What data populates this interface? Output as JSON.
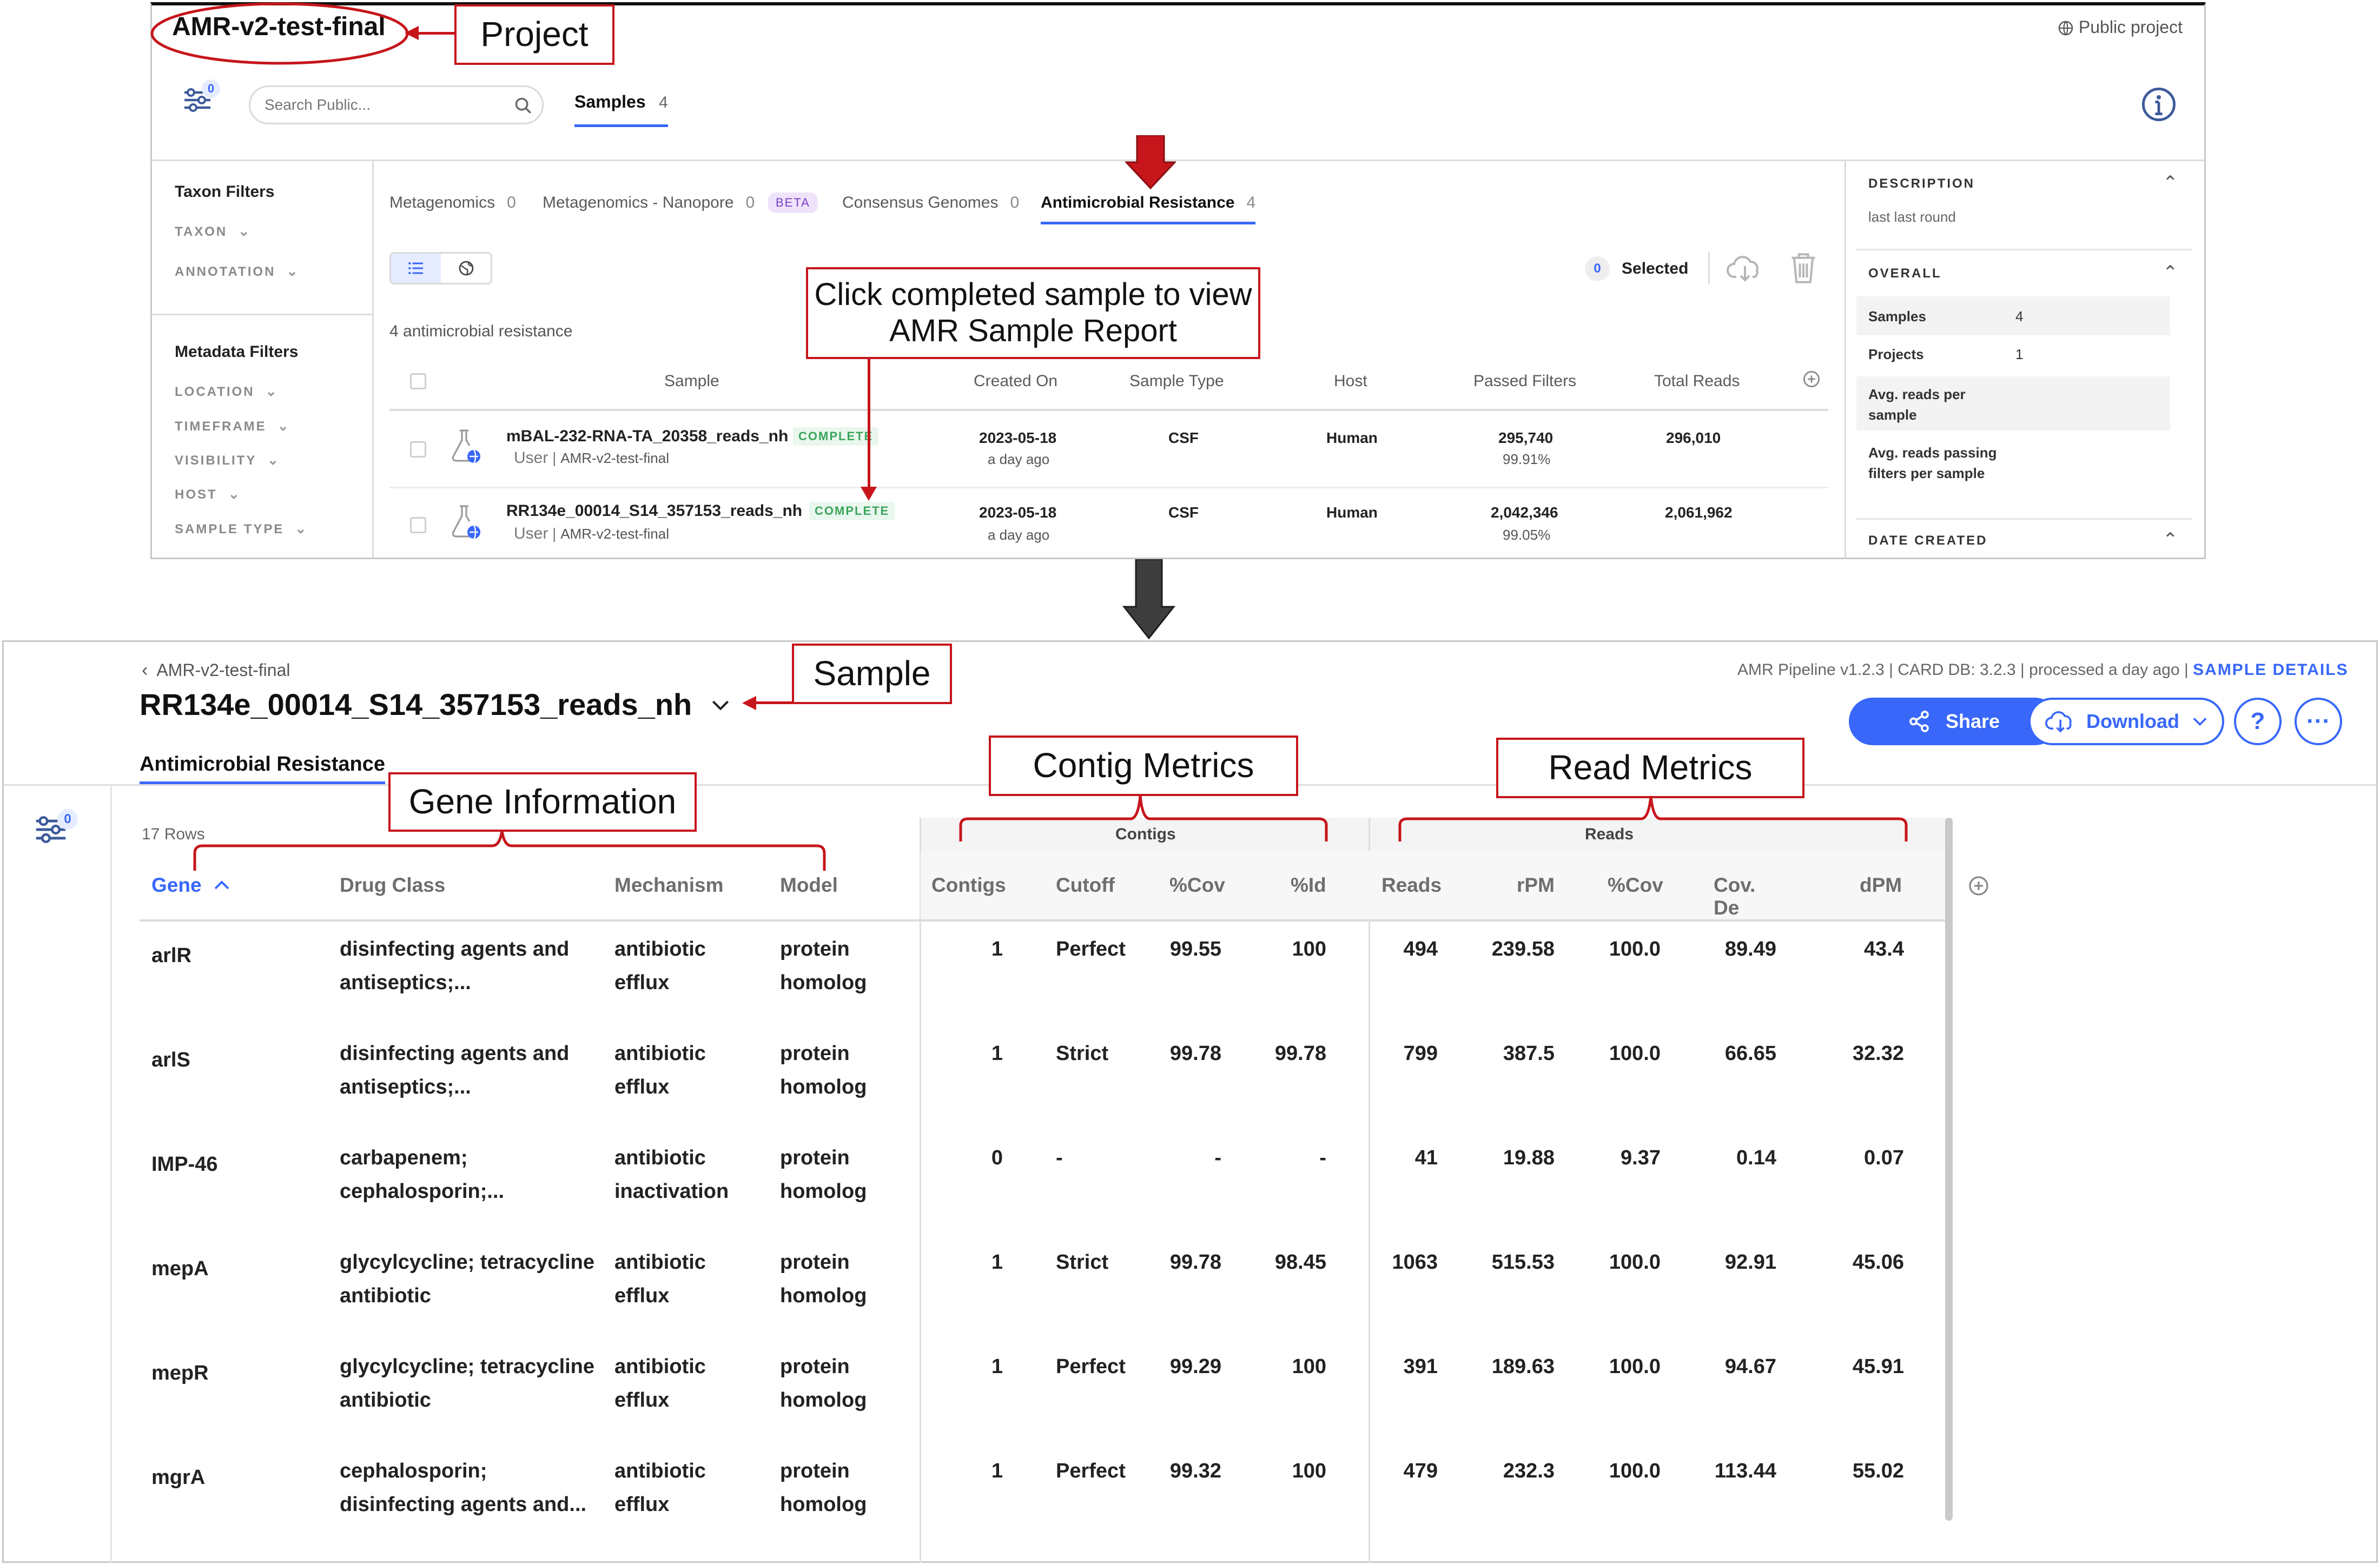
{
  "project_panel": {
    "project_title": "AMR-v2-test-final",
    "public_project": "Public project",
    "filter_count": "0",
    "search_placeholder": "Search Public...",
    "samples_tab": {
      "label": "Samples",
      "count": "4"
    },
    "taxon_filters": {
      "heading": "Taxon Filters",
      "items": [
        "TAXON",
        "ANNOTATION"
      ]
    },
    "metadata_filters": {
      "heading": "Metadata Filters",
      "items": [
        "LOCATION",
        "TIMEFRAME",
        "VISIBILITY",
        "HOST",
        "SAMPLE TYPE"
      ]
    },
    "workflow_tabs": [
      {
        "label": "Metagenomics",
        "count": "0"
      },
      {
        "label": "Metagenomics - Nanopore",
        "count": "0",
        "badge": "BETA"
      },
      {
        "label": "Consensus Genomes",
        "count": "0"
      },
      {
        "label": "Antimicrobial Resistance",
        "count": "4"
      }
    ],
    "selected_count": "0",
    "selected_label": "Selected",
    "result_count_text": "4 antimicrobial resistance",
    "table_headers": [
      "Sample",
      "Created On",
      "Sample Type",
      "Host",
      "Passed Filters",
      "Total Reads"
    ],
    "rows": [
      {
        "name": "mBAL-232-RNA-TA_20358_reads_nh",
        "status": "COMPLETE",
        "user": "User",
        "project": "AMR-v2-test-final",
        "created_date": "2023-05-18",
        "created_ago": "a day ago",
        "sample_type": "CSF",
        "host": "Human",
        "passed_filters": "295,740",
        "passed_pct": "99.91%",
        "total_reads": "296,010"
      },
      {
        "name": "RR134e_00014_S14_357153_reads_nh",
        "status": "COMPLETE",
        "user": "User",
        "project": "AMR-v2-test-final",
        "created_date": "2023-05-18",
        "created_ago": "a day ago",
        "sample_type": "CSF",
        "host": "Human",
        "passed_filters": "2,042,346",
        "passed_pct": "99.05%",
        "total_reads": "2,061,962"
      }
    ],
    "sidebar": {
      "description_heading": "DESCRIPTION",
      "description_text": "last last round",
      "overall_heading": "OVERALL",
      "metrics": [
        {
          "label": "Samples",
          "value": "4"
        },
        {
          "label": "Projects",
          "value": "1"
        },
        {
          "label_lines": [
            "Avg. reads per",
            "sample"
          ],
          "value": ""
        },
        {
          "label_lines": [
            "Avg. reads passing",
            "filters per sample"
          ],
          "value": ""
        }
      ],
      "date_created_heading": "DATE CREATED"
    }
  },
  "sample_panel": {
    "back_link": "AMR-v2-test-final",
    "sample_title": "RR134e_00014_S14_357153_reads_nh",
    "pipeline_info": "AMR Pipeline v1.2.3 | CARD DB: 3.2.3 | processed a day ago |",
    "sample_details_link": "SAMPLE DETAILS",
    "share_label": "Share",
    "download_label": "Download",
    "help_label": "?",
    "more_label": "···",
    "active_tab": "Antimicrobial Resistance",
    "filter_count": "0",
    "rows_count": "17 Rows",
    "group_headers": {
      "contigs": "Contigs",
      "reads": "Reads"
    },
    "columns": [
      "Gene",
      "Drug Class",
      "Mechanism",
      "Model",
      "Contigs",
      "Cutoff",
      "%Cov",
      "%Id",
      "Reads",
      "rPM",
      "%Cov",
      "Cov. De",
      "dPM"
    ],
    "rows": [
      {
        "gene": "arlR",
        "drug_class": [
          "disinfecting agents and",
          "antiseptics;..."
        ],
        "mechanism": [
          "antibiotic",
          "efflux"
        ],
        "model": [
          "protein",
          "homolog"
        ],
        "contigs": "1",
        "cutoff": "Perfect",
        "contig_cov": "99.55",
        "contig_id": "100",
        "reads": "494",
        "rpm": "239.58",
        "read_cov": "100.0",
        "cov_depth": "89.49",
        "dpm": "43.4"
      },
      {
        "gene": "arlS",
        "drug_class": [
          "disinfecting agents and",
          "antiseptics;..."
        ],
        "mechanism": [
          "antibiotic",
          "efflux"
        ],
        "model": [
          "protein",
          "homolog"
        ],
        "contigs": "1",
        "cutoff": "Strict",
        "contig_cov": "99.78",
        "contig_id": "99.78",
        "reads": "799",
        "rpm": "387.5",
        "read_cov": "100.0",
        "cov_depth": "66.65",
        "dpm": "32.32"
      },
      {
        "gene": "IMP-46",
        "drug_class": [
          "carbapenem;",
          "cephalosporin;..."
        ],
        "mechanism": [
          "antibiotic",
          "inactivation"
        ],
        "model": [
          "protein",
          "homolog"
        ],
        "contigs": "0",
        "cutoff": "-",
        "contig_cov": "-",
        "contig_id": "-",
        "reads": "41",
        "rpm": "19.88",
        "read_cov": "9.37",
        "cov_depth": "0.14",
        "dpm": "0.07"
      },
      {
        "gene": "mepA",
        "drug_class": [
          "glycylcycline; tetracycline",
          "antibiotic"
        ],
        "mechanism": [
          "antibiotic",
          "efflux"
        ],
        "model": [
          "protein",
          "homolog"
        ],
        "contigs": "1",
        "cutoff": "Strict",
        "contig_cov": "99.78",
        "contig_id": "98.45",
        "reads": "1063",
        "rpm": "515.53",
        "read_cov": "100.0",
        "cov_depth": "92.91",
        "dpm": "45.06"
      },
      {
        "gene": "mepR",
        "drug_class": [
          "glycylcycline; tetracycline",
          "antibiotic"
        ],
        "mechanism": [
          "antibiotic",
          "efflux"
        ],
        "model": [
          "protein",
          "homolog"
        ],
        "contigs": "1",
        "cutoff": "Perfect",
        "contig_cov": "99.29",
        "contig_id": "100",
        "reads": "391",
        "rpm": "189.63",
        "read_cov": "100.0",
        "cov_depth": "94.67",
        "dpm": "45.91"
      },
      {
        "gene": "mgrA",
        "drug_class": [
          "cephalosporin;",
          "disinfecting agents and..."
        ],
        "mechanism": [
          "antibiotic",
          "efflux"
        ],
        "model": [
          "protein",
          "homolog"
        ],
        "contigs": "1",
        "cutoff": "Perfect",
        "contig_cov": "99.32",
        "contig_id": "100",
        "reads": "479",
        "rpm": "232.3",
        "read_cov": "100.0",
        "cov_depth": "113.44",
        "dpm": "55.02"
      }
    ]
  },
  "annotations": {
    "project": "Project",
    "click_note": [
      "Click completed sample to view",
      "AMR Sample Report"
    ],
    "sample": "Sample",
    "gene_information": "Gene Information",
    "contig_metrics": "Contig Metrics",
    "read_metrics": "Read Metrics"
  },
  "colors": {
    "accent_blue": "#3867fa",
    "annotation_red": "#c6151b",
    "complete_green": "#3ba55c",
    "arrow_dark": "#3d3d3d"
  }
}
